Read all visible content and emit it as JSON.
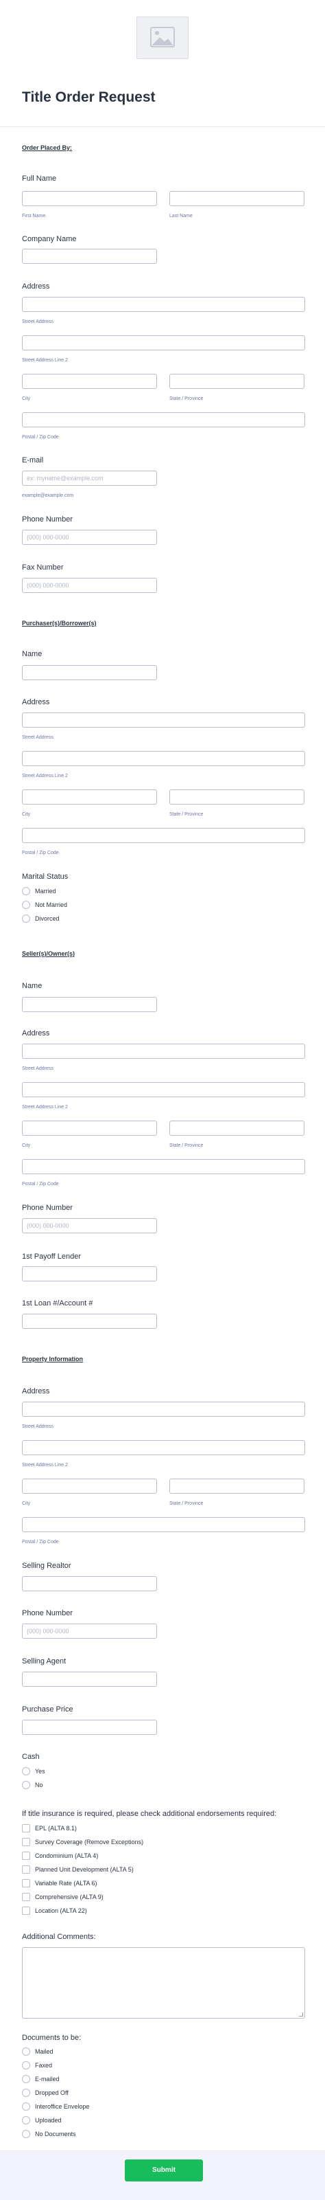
{
  "form": {
    "title": "Title Order Request",
    "submit_label": "Submit"
  },
  "order_placed_by": {
    "section_title": "Order Placed By:",
    "full_name_label": "Full Name",
    "first_name_sub": "First Name",
    "last_name_sub": "Last Name",
    "company_label": "Company Name",
    "address_label": "Address",
    "street1_sub": "Street Address",
    "street2_sub": "Street Address Line 2",
    "city_sub": "City",
    "state_sub": "State / Province",
    "postal_sub": "Postal / Zip Code",
    "email_label": "E-mail",
    "email_placeholder": "ex: myname@example.com",
    "email_sub": "example@example.com",
    "phone_label": "Phone Number",
    "phone_placeholder": "(000) 000-0000",
    "fax_label": "Fax Number",
    "fax_placeholder": "(000) 000-0000"
  },
  "purchaser": {
    "section_title": "Purchaser(s)/Borrower(s)",
    "name_label": "Name",
    "address_label": "Address",
    "street1_sub": "Street Address",
    "street2_sub": "Street Address Line 2",
    "city_sub": "City",
    "state_sub": "State / Province",
    "postal_sub": "Postal / Zip Code",
    "marital_label": "Marital Status",
    "marital_options": [
      "Married",
      "Not Married",
      "Divorced"
    ]
  },
  "seller": {
    "section_title": "Seller(s)/Owner(s)",
    "name_label": "Name",
    "address_label": "Address",
    "street1_sub": "Street Address",
    "street2_sub": "Street Address Line 2",
    "city_sub": "City",
    "state_sub": "State / Province",
    "postal_sub": "Postal / Zip Code",
    "phone_label": "Phone Number",
    "phone_placeholder": "(000) 000-0000",
    "payoff_label": "1st Payoff Lender",
    "loan_label": "1st Loan #/Account #"
  },
  "property": {
    "section_title": "Property Information",
    "address_label": "Address",
    "street1_sub": "Street Address",
    "street2_sub": "Street Address Line 2",
    "city_sub": "City",
    "state_sub": "State / Province",
    "postal_sub": "Postal / Zip Code",
    "selling_realtor_label": "Selling Realtor",
    "phone_label": "Phone Number",
    "phone_placeholder": "(000) 000-0000",
    "selling_agent_label": "Selling Agent",
    "purchase_price_label": "Purchase Price",
    "cash_label": "Cash",
    "cash_options": [
      "Yes",
      "No"
    ],
    "endorsements_label": "If title insurance is required, please check additional endorsements required:",
    "endorsements": [
      "EPL (ALTA 8.1)",
      "Survey Coverage (Remove Exceptions)",
      "Condominium (ALTA 4)",
      "Planned Unit Development (ALTA 5)",
      "Variable Rate (ALTA 6)",
      "Comprehensive (ALTA 9)",
      "Location (ALTA 22)"
    ],
    "comments_label": "Additional Comments:",
    "documents_label": "Documents to be:",
    "documents": [
      "Mailed",
      "Faxed",
      "E-mailed",
      "Dropped Off",
      "Interoffice Envelope",
      "Uploaded",
      "No Documents"
    ]
  }
}
